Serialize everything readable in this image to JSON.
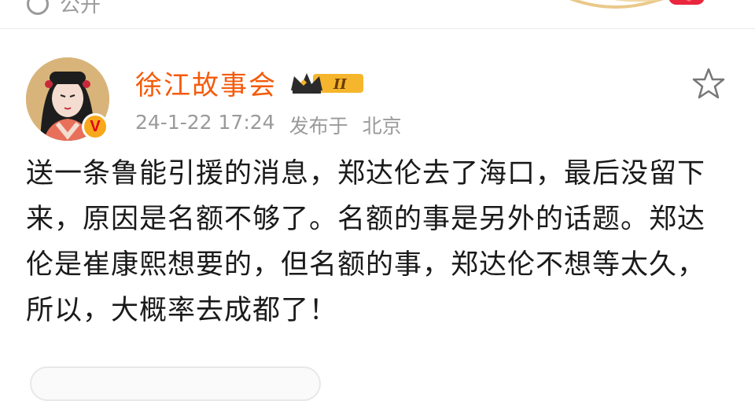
{
  "top": {
    "privacy_label": "公开",
    "privacy_icon": "globe-icon"
  },
  "post": {
    "author": "徐江故事会",
    "vip_level": "II",
    "timestamp": "24-1-22 17:24",
    "published_label": "发布于",
    "location": "北京",
    "verified_icon": "verified-v-icon",
    "favorite_icon": "star-icon",
    "text": "送一条鲁能引援的消息，郑达伦去了海口，最后没留下来，原因是名额不够了。名额的事是另外的话题。郑达伦是崔康熙想要的，但名额的事，郑达伦不想等太久，所以，大概率去成都了！"
  },
  "colors": {
    "username": "#f55a0a",
    "meta": "#9a9a9a",
    "verified_bg": "#f7a81b"
  }
}
